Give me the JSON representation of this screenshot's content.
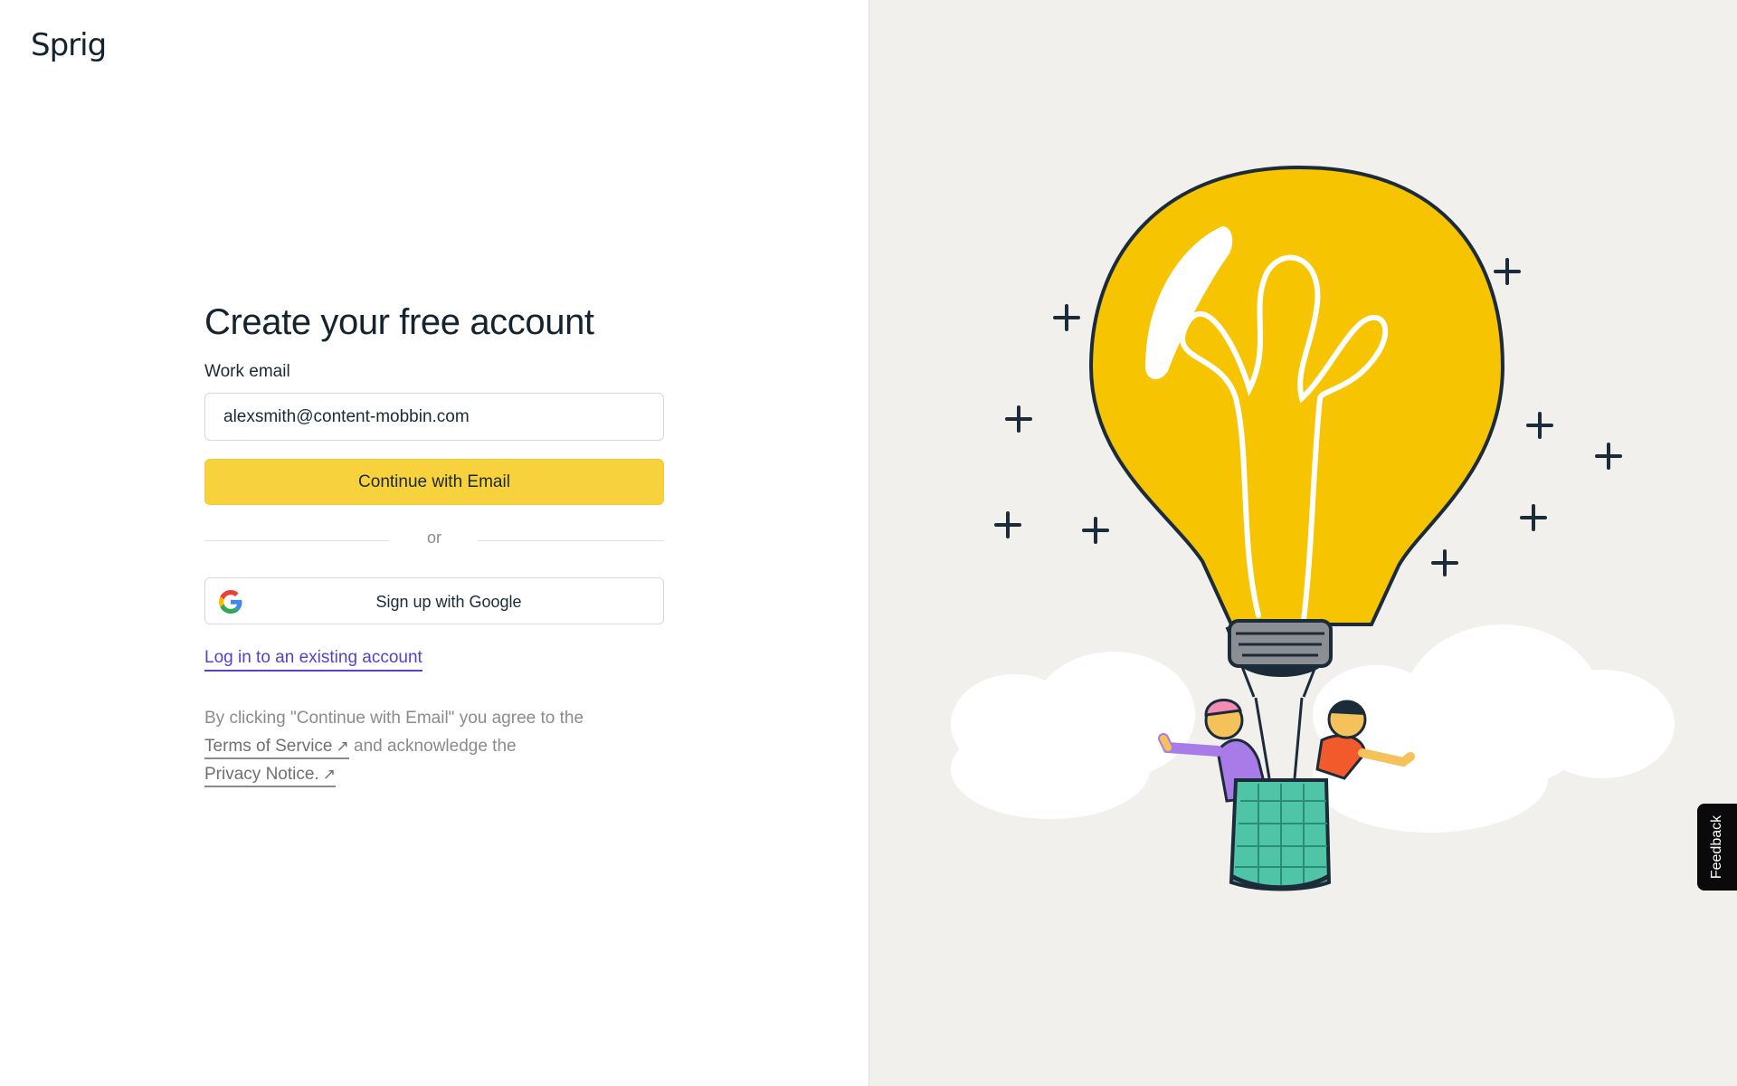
{
  "brand": {
    "logo_text": "Sprig"
  },
  "form": {
    "title": "Create your free account",
    "email_label": "Work email",
    "email_value": "alexsmith@content-mobbin.com",
    "continue_label": "Continue with Email",
    "divider_text": "or",
    "google_label": "Sign up with Google",
    "login_link": "Log in to an existing account"
  },
  "legal": {
    "prefix": "By clicking \"Continue with Email\" you agree to the",
    "terms_label": "Terms of Service",
    "middle": "and acknowledge the",
    "privacy_label": "Privacy Notice.",
    "arrow_icon": "external-link-icon"
  },
  "feedback": {
    "label": "Feedback"
  },
  "colors": {
    "accent_yellow": "#f8d23c",
    "link_purple": "#5542c8",
    "illustration_bg": "#f2f0ec",
    "text_dark": "#14232e"
  },
  "icons": {
    "google": "google-g-icon",
    "external": "external-link-icon"
  }
}
